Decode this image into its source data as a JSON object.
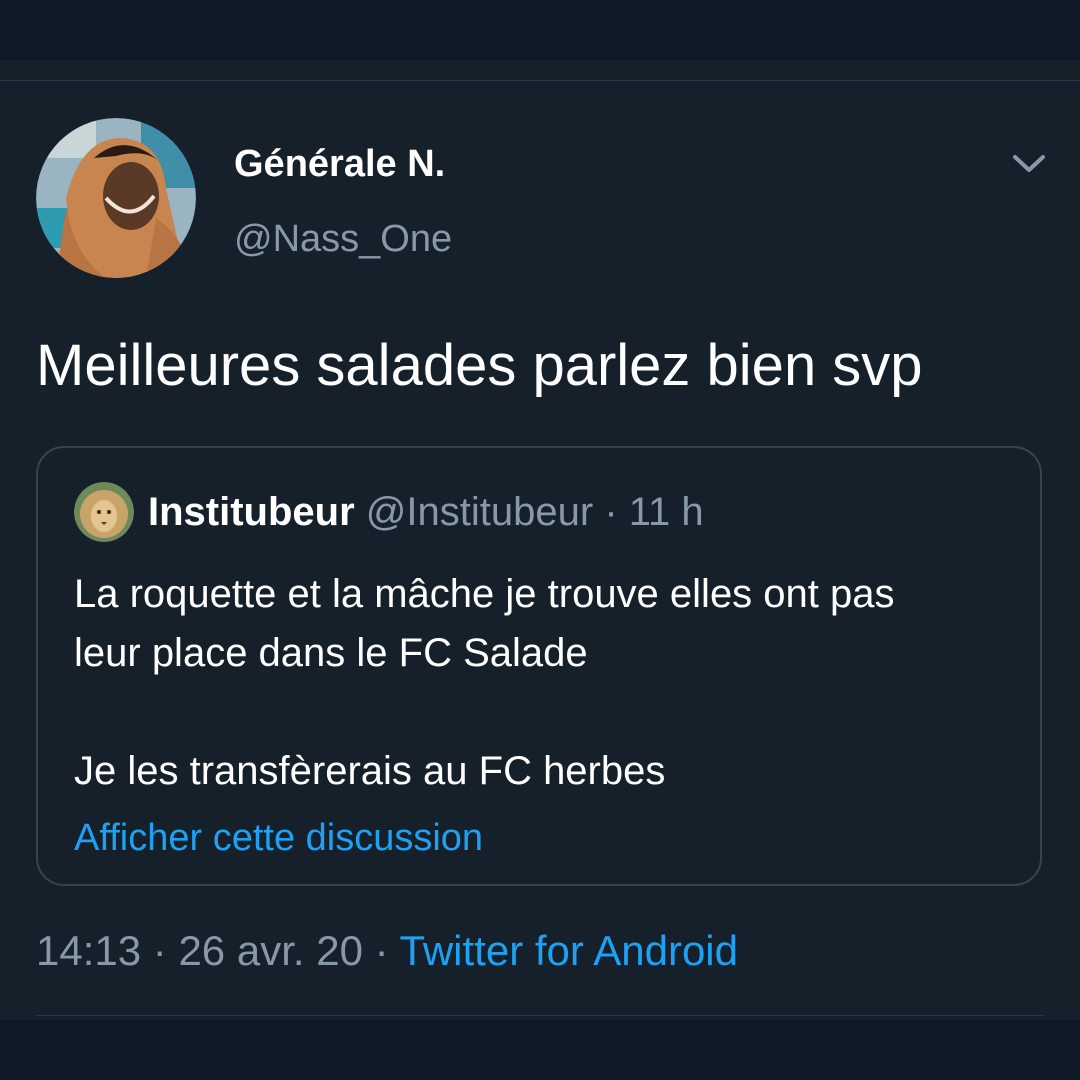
{
  "tweet": {
    "author": {
      "name": "Générale N.",
      "handle": "@Nass_One",
      "avatar_icon": "avatar-photo-icon"
    },
    "menu_icon": "chevron-down-icon",
    "text": "Meilleures salades parlez bien svp",
    "quoted": {
      "author_name": "Institubeur",
      "author_handle": "@Institubeur",
      "separator": "·",
      "time_ago": "11 h",
      "avatar_icon": "lion-avatar-icon",
      "lines": [
        "La roquette et la mâche je trouve elles ont pas",
        "leur place dans le FC Salade",
        "Je les transfèrerais au FC herbes"
      ],
      "show_thread_label": "Afficher cette discussion"
    },
    "footer": {
      "time": "14:13",
      "separator": "·",
      "date": "26 avr. 20",
      "source": "Twitter for Android"
    }
  },
  "colors": {
    "background": "#15202b",
    "band": "#101a26",
    "text_primary": "#ffffff",
    "text_secondary": "#8899a6",
    "accent": "#1da1f2",
    "border": "#38444d"
  }
}
